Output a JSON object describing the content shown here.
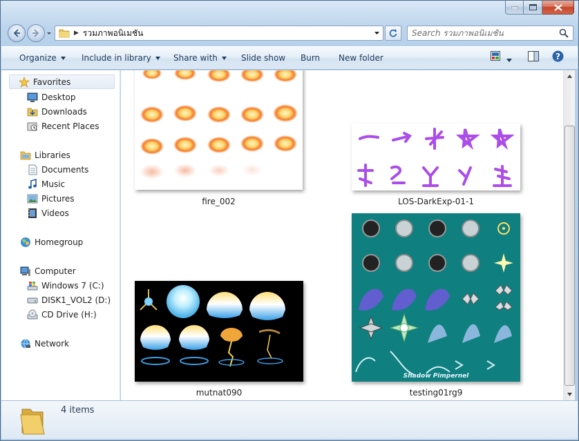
{
  "window": {
    "caption_buttons": [
      "minimize",
      "maximize",
      "close"
    ]
  },
  "address_bar": {
    "path": [
      "รวมภาพอนิเมชัน"
    ],
    "search_placeholder": "Search รวมภาพอนิเมชัน"
  },
  "toolbar": {
    "organize": "Organize",
    "include_in_library": "Include in library",
    "share_with": "Share with",
    "slide_show": "Slide show",
    "burn": "Burn",
    "new_folder": "New folder"
  },
  "nav": {
    "favorites": {
      "label": "Favorites",
      "items": [
        "Desktop",
        "Downloads",
        "Recent Places"
      ]
    },
    "libraries": {
      "label": "Libraries",
      "items": [
        "Documents",
        "Music",
        "Pictures",
        "Videos"
      ]
    },
    "homegroup": "Homegroup",
    "computer": {
      "label": "Computer",
      "items": [
        "Windows 7 (C:)",
        "DISK1_VOL2 (D:)",
        "CD Drive (H:)"
      ]
    },
    "network": "Network"
  },
  "files": [
    {
      "name": "fire_002",
      "icon": "image-thumbnail-fire"
    },
    {
      "name": "LOS-DarkExp-01-1",
      "icon": "image-thumbnail-purple-runes"
    },
    {
      "name": "mutnat090",
      "icon": "image-thumbnail-blue-orbs"
    },
    {
      "name": "testing01rg9",
      "icon": "image-thumbnail-teal-sprites",
      "watermark": "Shadow Pimpernel"
    }
  ],
  "details": {
    "item_count": "4 items"
  },
  "colors": {
    "toolbar_text": "#1e3a5c",
    "window_frame": "#b8d1eb",
    "close_button": "#c4452a"
  }
}
